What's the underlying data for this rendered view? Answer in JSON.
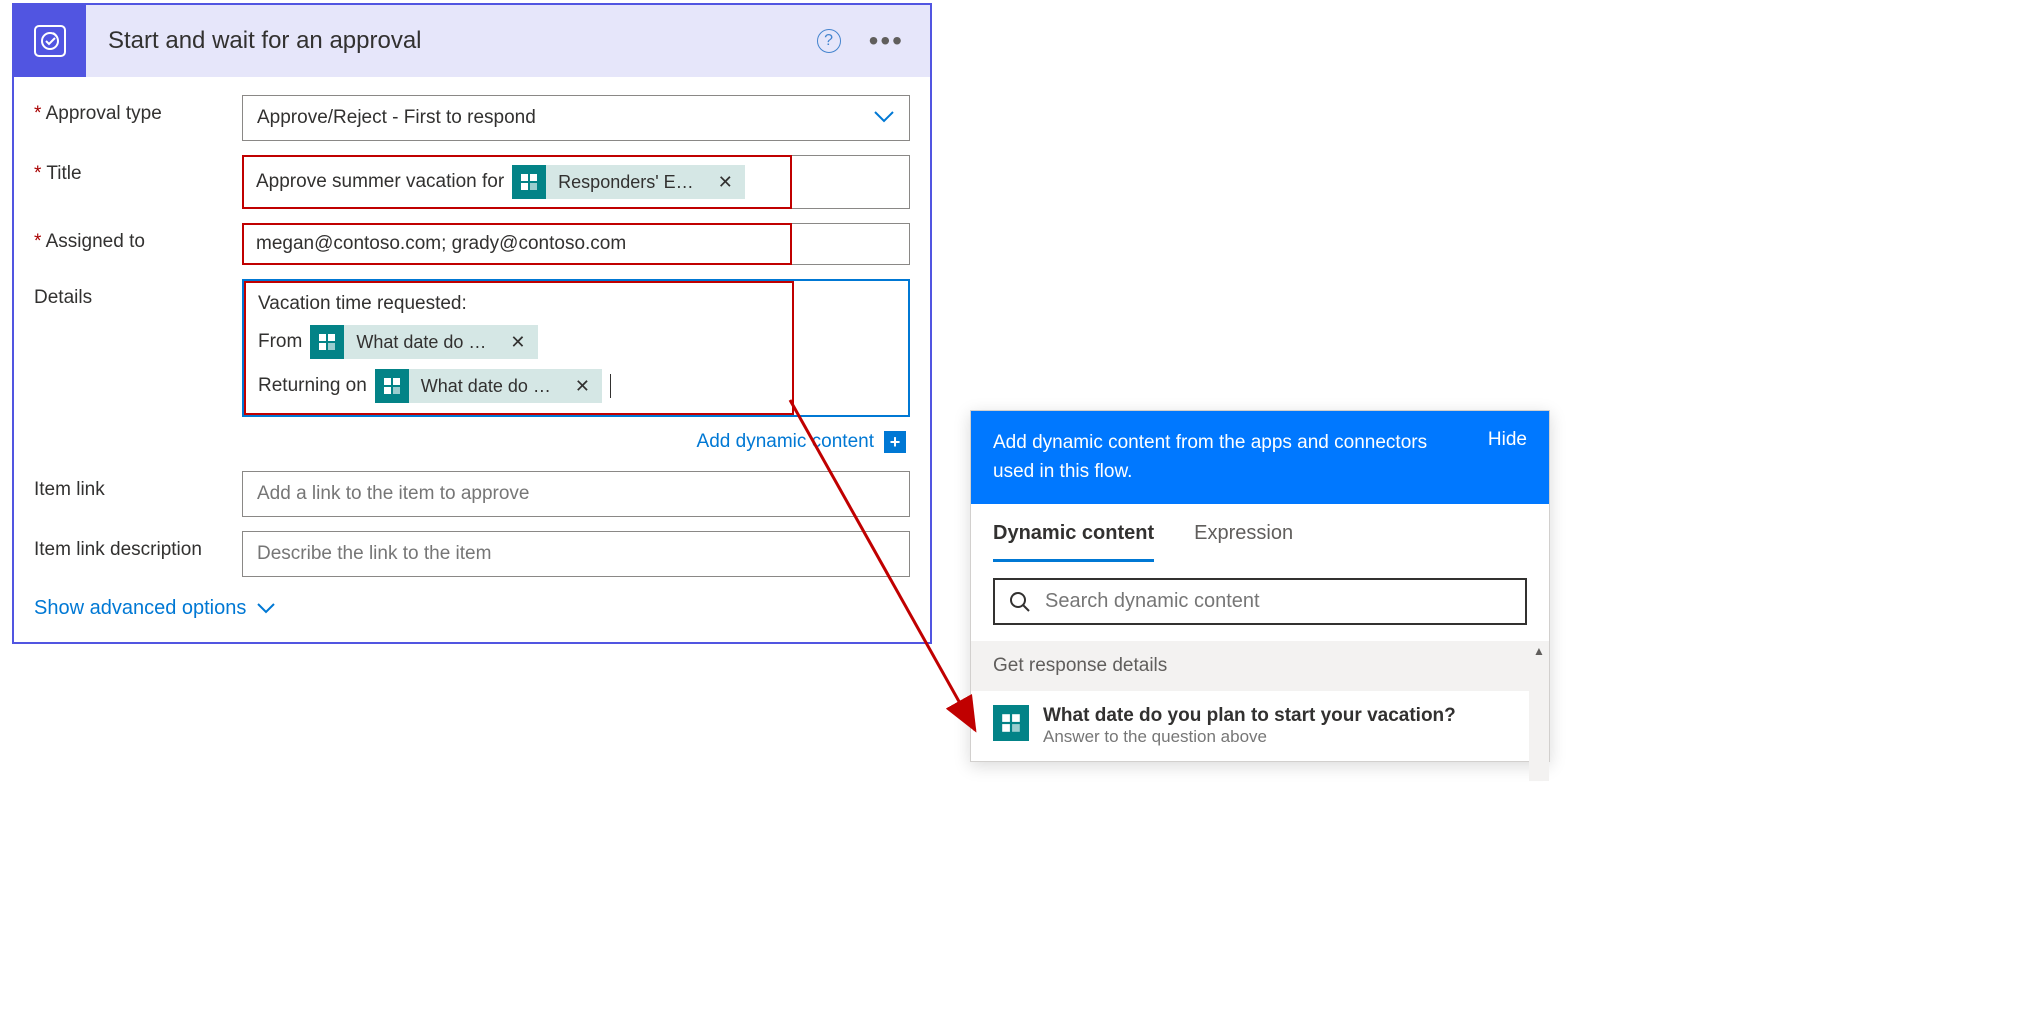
{
  "card": {
    "title": "Start and wait for an approval",
    "fields": {
      "approval_type": {
        "label": "Approval type",
        "value": "Approve/Reject - First to respond"
      },
      "title": {
        "label": "Title",
        "prefix_text": "Approve summer vacation for ",
        "token": "Responders' E…"
      },
      "assigned_to": {
        "label": "Assigned to",
        "value": "megan@contoso.com; grady@contoso.com"
      },
      "details": {
        "label": "Details",
        "line1": "Vacation time requested:",
        "line2_prefix": "From",
        "line2_token": "What date do …",
        "line3_prefix": "Returning on",
        "line3_token": "What date do …"
      },
      "item_link": {
        "label": "Item link",
        "placeholder": "Add a link to the item to approve"
      },
      "item_link_desc": {
        "label": "Item link description",
        "placeholder": "Describe the link to the item"
      }
    },
    "dynamic_link": "Add dynamic content",
    "advanced": "Show advanced options"
  },
  "dc_panel": {
    "header_text": "Add dynamic content from the apps and connectors used in this flow.",
    "hide": "Hide",
    "tab_dynamic": "Dynamic content",
    "tab_expression": "Expression",
    "search_placeholder": "Search dynamic content",
    "section": "Get response details",
    "item_title": "What date do you plan to start your vacation?",
    "item_sub": "Answer to the question above"
  }
}
